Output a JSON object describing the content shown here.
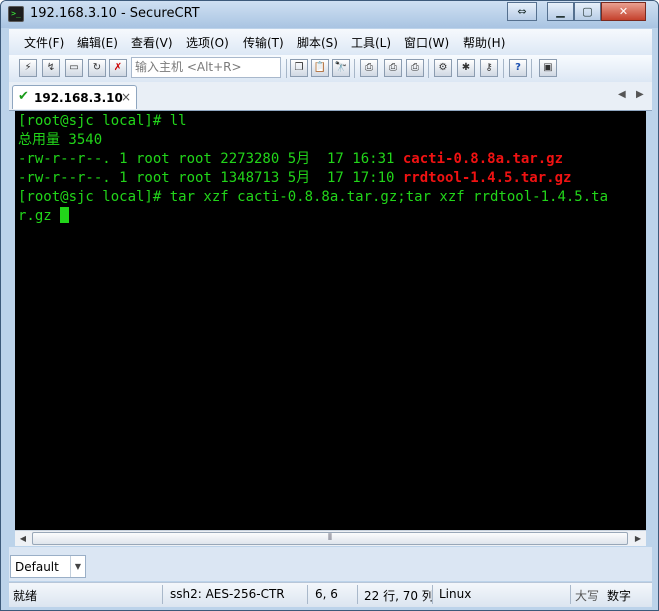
{
  "window": {
    "title": "192.168.3.10 - SecureCRT"
  },
  "menu": [
    "文件(F)",
    "编辑(E)",
    "查看(V)",
    "选项(O)",
    "传输(T)",
    "脚本(S)",
    "工具(L)",
    "窗口(W)",
    "帮助(H)"
  ],
  "toolbar": {
    "quick_connect_placeholder": "输入主机 <Alt+R>"
  },
  "tab": {
    "label": "192.168.3.10",
    "close": "×"
  },
  "terminal": {
    "lines": [
      {
        "text": "[root@sjc local]# ll"
      },
      {
        "text": "总用量 3540"
      },
      {
        "text": "-rw-r--r--. 1 root root 2273280 5月  17 16:31 ",
        "file": "cacti-0.8.8a.tar.gz"
      },
      {
        "text": "-rw-r--r--. 1 root root 1348713 5月  17 17:10 ",
        "file": "rrdtool-1.4.5.tar.gz"
      },
      {
        "text": "[root@sjc local]# tar xzf cacti-0.8.8a.tar.gz;tar xzf rrdtool-1.4.5.ta"
      },
      {
        "text": "r.gz "
      }
    ],
    "colors": {
      "background": "#000000",
      "text": "#22d51a",
      "archive": "#f01212"
    }
  },
  "session_select": {
    "value": "Default"
  },
  "status": {
    "ready": "就绪",
    "protocol": "ssh2: AES-256-CTR",
    "position": "6,   6",
    "size": "22 行, 70 列",
    "os": "Linux",
    "caps": "大写",
    "num": "数字"
  }
}
